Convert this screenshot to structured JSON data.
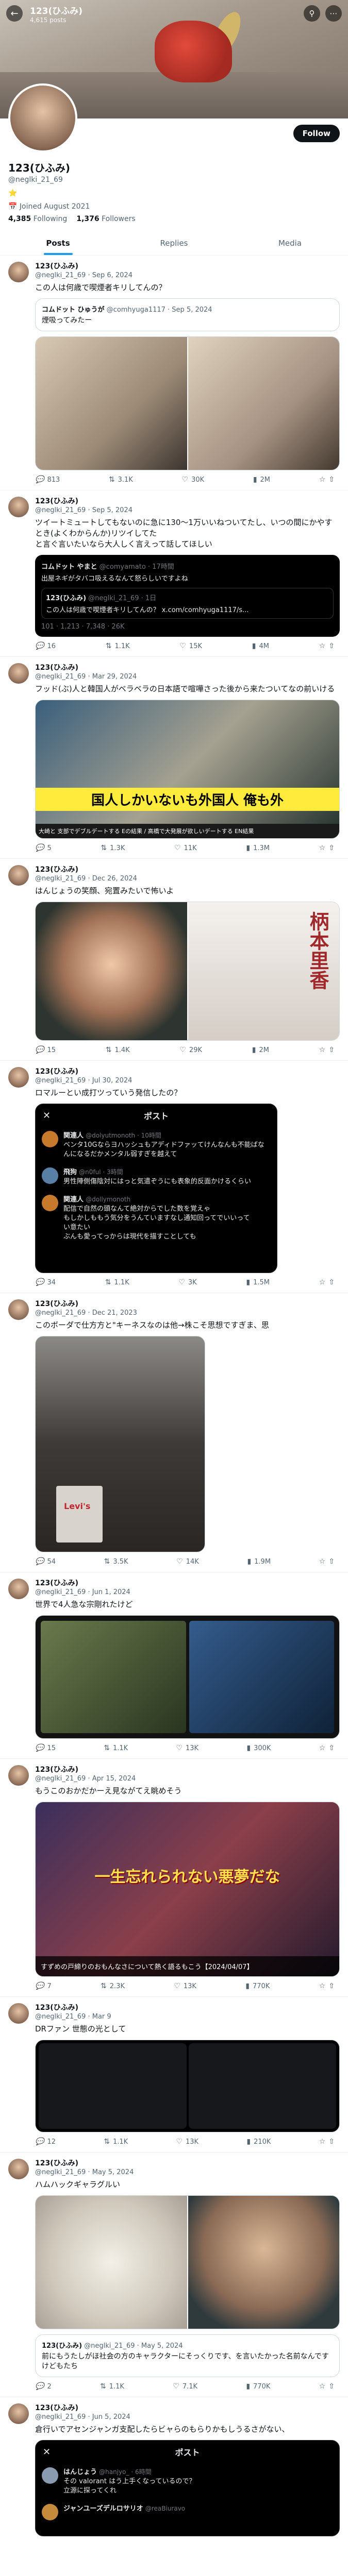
{
  "header": {
    "name": "123(ひふみ)",
    "posts_count": "4,615 posts"
  },
  "profile": {
    "display_name": "123(ひふみ)",
    "handle": "@neglki_21_69",
    "badge": "⭐",
    "joined": "Joined August 2021",
    "following_count": "4,385",
    "following_label": "Following",
    "followers_count": "1,376",
    "followers_label": "Followers",
    "follow_label": "Follow"
  },
  "tabs": [
    {
      "label": "Posts"
    },
    {
      "label": "Replies"
    },
    {
      "label": "Media"
    }
  ],
  "tweets": [
    {
      "name": "123(ひふみ)",
      "meta": "@neglki_21_69 · Sep 6, 2024",
      "text": "この人は何歳で喫煙者キリしてんの？",
      "quote": {
        "name": "コムドット ひゅうが",
        "handle": "@comhyuga1117 · Sep 5, 2024",
        "text": "煙吸ってみたー"
      },
      "replies": "813",
      "reposts": "3.1K",
      "likes": "30K",
      "views": "2M"
    },
    {
      "name": "123(ひふみ)",
      "meta": "@neglki_21_69 · Sep 5, 2024",
      "text": "ツイートミュートしてもないのに急に130〜1万いいねついてたし、いつの間にかやすとき(よくわからんか)リツイしてた\nと言ぐ言いたいなら大人しく言えって話してほしい",
      "quote": {
        "name": "コムドット やまと",
        "handle": "@comyamato · 17時間",
        "text": "出屋ネギがタバコ吸えるなんて怒らしいですよね",
        "inner_name": "123(ひふみ)",
        "inner_handle": "@neglki_21_69 · 1日",
        "inner_text": "この人は何歳で喫煙者キリしてんの？ x.com/comhyuga1117/s..."
      },
      "qc_stats": "101 · 1,213 · 7,348 · 26K",
      "replies": "16",
      "reposts": "1.1K",
      "likes": "15K",
      "views": "4M"
    },
    {
      "name": "123(ひふみ)",
      "meta": "@neglki_21_69 · Mar 29, 2024",
      "text": "フッド(ぶ)人と韓国人がベラベラの日本語で喧嘩さった後から来たついてなの前いける",
      "media_caption": "国人しかいないも外国人 俺も外",
      "media_sub": "大崎と 支部でデブルデートする Eの結果 / 高橋で大発展が欲しいデートする EN結果",
      "replies": "5",
      "reposts": "1.3K",
      "likes": "11K",
      "views": "1.3M"
    },
    {
      "name": "123(ひふみ)",
      "meta": "@neglki_21_69 · Dec 26, 2024",
      "text": "はんじょうの笑顔、宛置みたいで怖いよ",
      "media_caption": "柄本里香",
      "replies": "15",
      "reposts": "1.4K",
      "likes": "29K",
      "views": "2M"
    },
    {
      "name": "123(ひふみ)",
      "meta": "@neglki_21_69 · Jul 30, 2024",
      "text": "ロマルーとい成打ツっていう発信したの？",
      "dark": {
        "title": "ポスト",
        "rows": [
          {
            "name": "関連人",
            "sub": "@dolyutmonoth · 10時間",
            "text": "ベンタ10Gならヨハッシュもアディドファッてけんなんも不能ばなんになるだかメンタル弱すぎを越えて"
          },
          {
            "name": "飛狗",
            "sub": "@n0ful · 3時間",
            "text": "男性陣側傷陰対にはっと気遣ぞうにも表象的反面かけるくらい"
          },
          {
            "name": "関連人",
            "sub": "@dollymonoth",
            "text": "配信で自然の頭なんて絶対からでした数を覚えゃ\nもしかしももう気分をうんていますなし通知回ってでいいって\nい意たい\nぶんも愛ってっからは現代を描すことしても"
          }
        ]
      },
      "replies": "34",
      "reposts": "1.1K",
      "likes": "3K",
      "views": "1.5M"
    },
    {
      "name": "123(ひふみ)",
      "meta": "@neglki_21_69 · Dec 21, 2023",
      "text": "このボーダで仕方方と\"キーネスなのは他→株こそ思想ですぎま、思",
      "media_caption": "Levi's",
      "replies": "54",
      "reposts": "3.5K",
      "likes": "14K",
      "views": "1.9M"
    },
    {
      "name": "123(ひふみ)",
      "meta": "@neglki_21_69 · Jun 1, 2024",
      "text": "世界で4人急な宗剛れたけど",
      "replies": "15",
      "reposts": "1.1K",
      "likes": "13K",
      "views": "300K"
    },
    {
      "name": "123(ひふみ)",
      "meta": "@neglki_21_69 · Apr 15, 2024",
      "text": "もうこのおかだかーえ見ながてえ眺めそう",
      "media_caption": "一生忘れられない悪夢だな",
      "media_sub": "すずめの戸締りのおもんなさについて熱く語るもこう【2024/04/07】",
      "replies": "7",
      "reposts": "2.3K",
      "likes": "13K",
      "views": "770K"
    },
    {
      "name": "123(ひふみ)",
      "meta": "@neglki_21_69 · Mar 9",
      "text": "DRファン 世態の光として",
      "replies": "12",
      "reposts": "1.1K",
      "likes": "13K",
      "views": "210K"
    },
    {
      "name": "123(ひふみ)",
      "meta": "@neglki_21_69 · May 5, 2024",
      "text": "ハムハックギャラグルい",
      "quote": {
        "name": "123(ひふみ)",
        "handle": "@neglki_21_69 · May 5, 2024",
        "text": "前にもうたしがほ社会の方のキャラクターにそっくりです、を言いたかった名前なんですけどもたち"
      },
      "replies": "2",
      "reposts": "1.1K",
      "likes": "7.1K",
      "views": "770K"
    },
    {
      "name": "123(ひふみ)",
      "meta": "@neglki_21_69 · Jun 5, 2024",
      "text": "倉行いでアセンジャンガ支配したらビャらのもらりかもしうるさがない、",
      "dark": {
        "title": "ポスト",
        "rows": [
          {
            "name": "はんじょう",
            "sub": "@hanjyo_ · 6時間",
            "text": "その valorant はう上手くなっているので？\n立源に探ってくれ"
          },
          {
            "name": "ジャンユーズデルロサリオ",
            "sub": "@reaBiuravo",
            "text": ""
          }
        ]
      },
      "replies": "",
      "reposts": "",
      "likes": "",
      "views": ""
    }
  ]
}
